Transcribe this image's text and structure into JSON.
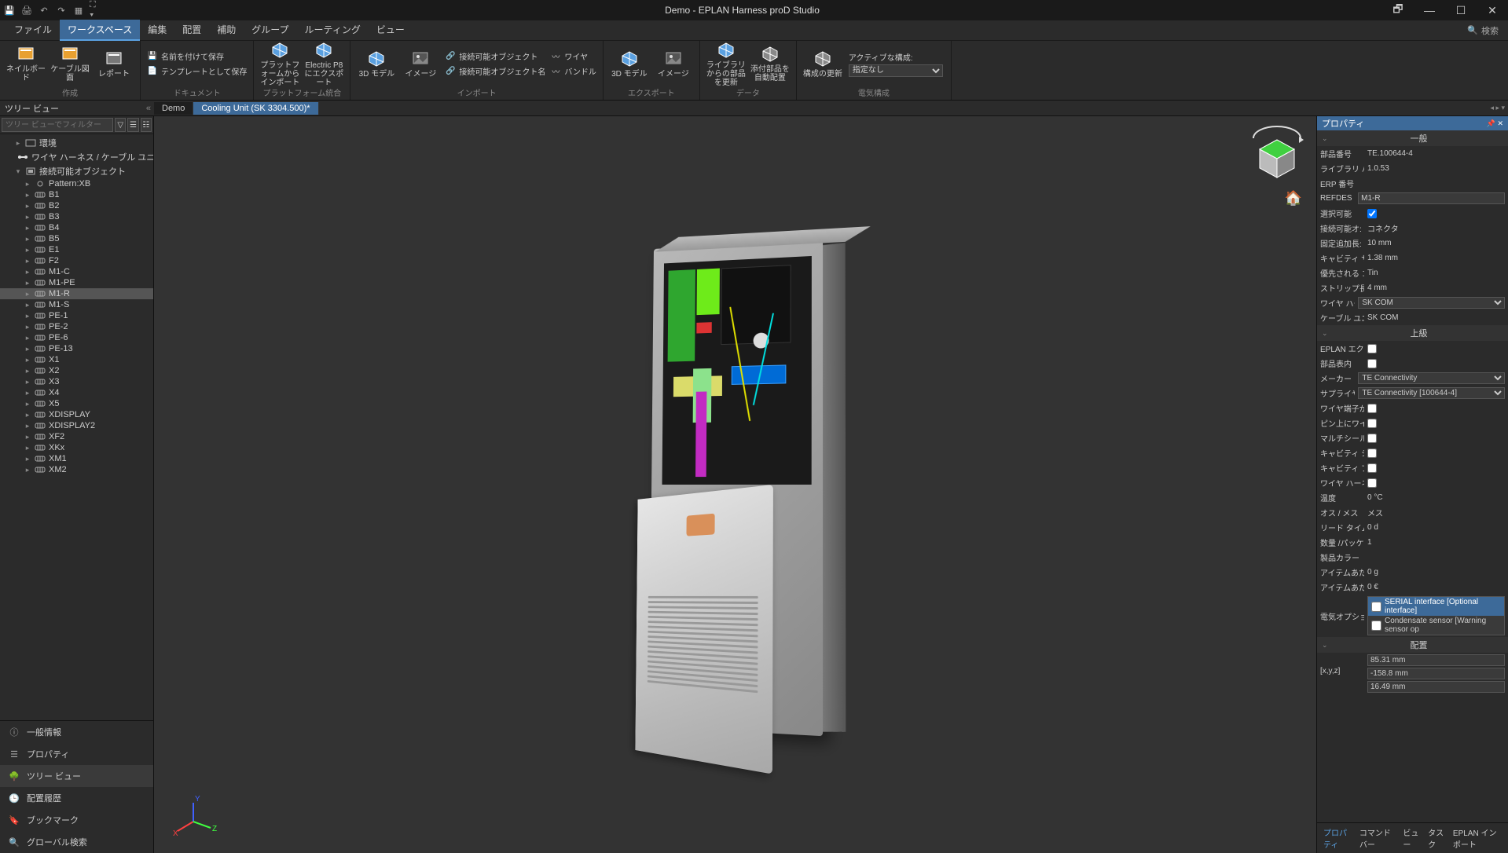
{
  "title": "Demo - EPLAN Harness proD Studio",
  "menu": {
    "items": [
      "ファイル",
      "ワークスペース",
      "編集",
      "配置",
      "補助",
      "グループ",
      "ルーティング",
      "ビュー"
    ],
    "active_index": 1,
    "search_icon": "🔍",
    "search": "検索"
  },
  "ribbon": {
    "groups": [
      {
        "label": "作成",
        "large": [
          {
            "icon": "nb",
            "label": "ネイルボード",
            "color": "#e8a030"
          },
          {
            "icon": "cb",
            "label": "ケーブル図面",
            "color": "#e8a030"
          },
          {
            "icon": "rp",
            "label": "レポート",
            "color": "#777"
          }
        ]
      },
      {
        "label": "ドキュメント",
        "small": [
          {
            "icon": "💾",
            "label": "名前を付けて保存"
          },
          {
            "icon": "📄",
            "label": "テンプレートとして保存"
          }
        ]
      },
      {
        "label": "プラットフォーム統合",
        "large": [
          {
            "icon": "pf",
            "label": "プラットフォームからインポート",
            "color": "#5aa0e0"
          },
          {
            "icon": "ep",
            "label": "Electric P8 にエクスポート",
            "color": "#5aa0e0"
          }
        ]
      },
      {
        "label": "インポート",
        "large": [
          {
            "icon": "3d",
            "label": "3D モデル",
            "color": "#5aa0e0"
          },
          {
            "icon": "im",
            "label": "イメージ",
            "color": "#888"
          }
        ],
        "small": [
          {
            "icon": "🔗",
            "label": "接続可能オブジェクト"
          },
          {
            "icon": "🔗",
            "label": "接続可能オブジェクト名"
          }
        ],
        "small2": [
          {
            "icon": "〰",
            "label": "ワイヤ"
          },
          {
            "icon": "〰",
            "label": "バンドル"
          }
        ]
      },
      {
        "label": "エクスポート",
        "large": [
          {
            "icon": "3d",
            "label": "3D モデル",
            "color": "#5aa0e0"
          },
          {
            "icon": "im",
            "label": "イメージ",
            "color": "#888"
          }
        ]
      },
      {
        "label": "データ",
        "large": [
          {
            "icon": "lb",
            "label": "ライブラリからの部品を更新",
            "color": "#5aa0e0"
          },
          {
            "icon": "au",
            "label": "添付部品を自動配置",
            "color": "#888"
          }
        ]
      },
      {
        "label": "電気構成",
        "large": [
          {
            "icon": "cu",
            "label": "構成の更新",
            "color": "#888"
          }
        ],
        "combo": {
          "label": "アクティブな構成:",
          "value": "指定なし"
        }
      }
    ]
  },
  "pane_title": "ツリー ビュー",
  "tabs": [
    {
      "label": "Demo",
      "active": false
    },
    {
      "label": "Cooling Unit (SK 3304.500)*",
      "active": true
    }
  ],
  "filter_placeholder": "ツリー ビューでフィルター",
  "tree": [
    {
      "depth": 1,
      "exp": "▸",
      "icon": "env",
      "label": "環境"
    },
    {
      "depth": 1,
      "exp": " ",
      "icon": "wh",
      "label": "ワイヤ ハーネス / ケーブル ユニット"
    },
    {
      "depth": 1,
      "exp": "▾",
      "icon": "co",
      "label": "接続可能オブジェクト"
    },
    {
      "depth": 2,
      "exp": "▸",
      "icon": "pt",
      "label": "Pattern:XB"
    },
    {
      "depth": 2,
      "exp": "▸",
      "icon": "cn",
      "label": "B1"
    },
    {
      "depth": 2,
      "exp": "▸",
      "icon": "cn",
      "label": "B2"
    },
    {
      "depth": 2,
      "exp": "▸",
      "icon": "cn",
      "label": "B3"
    },
    {
      "depth": 2,
      "exp": "▸",
      "icon": "cn",
      "label": "B4"
    },
    {
      "depth": 2,
      "exp": "▸",
      "icon": "cn",
      "label": "B5"
    },
    {
      "depth": 2,
      "exp": "▸",
      "icon": "cn",
      "label": "E1"
    },
    {
      "depth": 2,
      "exp": "▸",
      "icon": "cn",
      "label": "F2"
    },
    {
      "depth": 2,
      "exp": "▸",
      "icon": "cn",
      "label": "M1-C"
    },
    {
      "depth": 2,
      "exp": "▸",
      "icon": "cn",
      "label": "M1-PE"
    },
    {
      "depth": 2,
      "exp": "▸",
      "icon": "cn",
      "label": "M1-R",
      "selected": true
    },
    {
      "depth": 2,
      "exp": "▸",
      "icon": "cn",
      "label": "M1-S"
    },
    {
      "depth": 2,
      "exp": "▸",
      "icon": "cn",
      "label": "PE-1"
    },
    {
      "depth": 2,
      "exp": "▸",
      "icon": "cn",
      "label": "PE-2"
    },
    {
      "depth": 2,
      "exp": "▸",
      "icon": "cn",
      "label": "PE-6"
    },
    {
      "depth": 2,
      "exp": "▸",
      "icon": "cn",
      "label": "PE-13"
    },
    {
      "depth": 2,
      "exp": "▸",
      "icon": "cn",
      "label": "X1"
    },
    {
      "depth": 2,
      "exp": "▸",
      "icon": "cn",
      "label": "X2"
    },
    {
      "depth": 2,
      "exp": "▸",
      "icon": "cn",
      "label": "X3"
    },
    {
      "depth": 2,
      "exp": "▸",
      "icon": "cn",
      "label": "X4"
    },
    {
      "depth": 2,
      "exp": "▸",
      "icon": "cn",
      "label": "X5"
    },
    {
      "depth": 2,
      "exp": "▸",
      "icon": "cn",
      "label": "XDISPLAY"
    },
    {
      "depth": 2,
      "exp": "▸",
      "icon": "cn",
      "label": "XDISPLAY2"
    },
    {
      "depth": 2,
      "exp": "▸",
      "icon": "cn",
      "label": "XF2"
    },
    {
      "depth": 2,
      "exp": "▸",
      "icon": "cn",
      "label": "XKx"
    },
    {
      "depth": 2,
      "exp": "▸",
      "icon": "cn",
      "label": "XM1"
    },
    {
      "depth": 2,
      "exp": "▸",
      "icon": "cn",
      "label": "XM2"
    }
  ],
  "left_bottom": [
    {
      "icon": "ⓘ",
      "label": "一般情報"
    },
    {
      "icon": "☰",
      "label": "プロパティ"
    },
    {
      "icon": "🌳",
      "label": "ツリー ビュー",
      "active": true
    },
    {
      "icon": "🕒",
      "label": "配置履歴"
    },
    {
      "icon": "🔖",
      "label": "ブックマーク"
    },
    {
      "icon": "🔍",
      "label": "グローバル検索"
    }
  ],
  "properties": {
    "header": "プロパティ",
    "sections": [
      {
        "title": "一般",
        "rows": [
          {
            "label": "部品番号",
            "type": "text",
            "value": "TE.100644-4"
          },
          {
            "label": "ライブラリ バー",
            "type": "text",
            "value": "1.0.53"
          },
          {
            "label": "ERP 番号",
            "type": "text",
            "value": ""
          },
          {
            "label": "REFDES",
            "type": "input",
            "value": "M1-R"
          },
          {
            "label": "選択可能",
            "type": "check",
            "value": true
          },
          {
            "label": "接続可能オ:",
            "type": "text",
            "value": "コネクタ"
          },
          {
            "label": "固定追加長:",
            "type": "text",
            "value": "10 mm"
          },
          {
            "label": "キャビティ サイ",
            "type": "text",
            "value": "1.38 mm"
          },
          {
            "label": "優先される コ",
            "type": "text",
            "value": "Tin"
          },
          {
            "label": "ストリップ長",
            "type": "text",
            "value": "4 mm"
          },
          {
            "label": "ワイヤ ハーネ",
            "type": "select",
            "value": "SK COM"
          },
          {
            "label": "ケーブル ユニ",
            "type": "text",
            "value": "SK COM"
          }
        ]
      },
      {
        "title": "上級",
        "rows": [
          {
            "label": "EPLAN エクス",
            "type": "check",
            "value": false
          },
          {
            "label": "部品表内",
            "type": "check",
            "value": false
          },
          {
            "label": "メーカー",
            "type": "select",
            "value": "TE Connectivity"
          },
          {
            "label": "サプライヤー",
            "type": "select",
            "value": "TE Connectivity [100644-4]"
          },
          {
            "label": "ワイヤ端子が",
            "type": "check",
            "value": false
          },
          {
            "label": "ピン上にワイヤ",
            "type": "check",
            "value": false
          },
          {
            "label": "マルチシール",
            "type": "check",
            "value": false
          },
          {
            "label": "キャビティ シー",
            "type": "check",
            "value": false
          },
          {
            "label": "キャビティ プラ",
            "type": "check",
            "value": false
          },
          {
            "label": "ワイヤ ハーネ",
            "type": "check",
            "value": false
          },
          {
            "label": "温度",
            "type": "text",
            "value": "0 °C"
          },
          {
            "label": "オス / メス",
            "type": "text",
            "value": "メス"
          },
          {
            "label": "リード タイム",
            "type": "text",
            "value": "0 d"
          },
          {
            "label": "数量 /パッケー",
            "type": "text",
            "value": "1"
          },
          {
            "label": "製品カラー",
            "type": "text",
            "value": ""
          },
          {
            "label": "アイテムあたり",
            "type": "text",
            "value": "0 g"
          },
          {
            "label": "アイテムあたり",
            "type": "text",
            "value": "0 €"
          }
        ],
        "options_label": "電気オプショ",
        "options": [
          {
            "checked": false,
            "label": "SERIAL interface [Optional interface]",
            "hl": true
          },
          {
            "checked": false,
            "label": "Condensate sensor [Warning sensor op"
          }
        ]
      },
      {
        "title": "配置",
        "rows_triple": {
          "label": "[x,y,z]",
          "values": [
            "85.31 mm",
            "-158.8 mm",
            "16.49 mm"
          ]
        }
      }
    ]
  },
  "right_tabs": [
    "プロパティ",
    "コマンド バー",
    "ビュー",
    "タスク",
    "EPLAN インポート"
  ],
  "right_active_tab": 0
}
